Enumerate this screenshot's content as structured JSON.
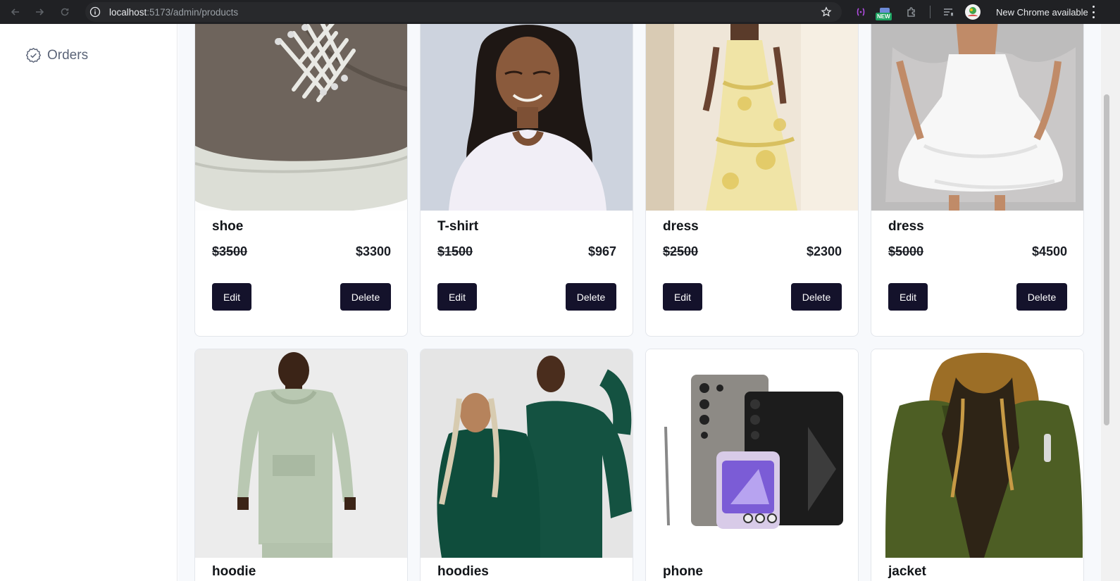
{
  "browser": {
    "url_host": "localhost",
    "url_path": ":5173/admin/products",
    "new_badge": "NEW",
    "update_text": "New Chrome available"
  },
  "sidebar": {
    "items": [
      {
        "label": "Orders",
        "icon": "badge-check-icon"
      }
    ]
  },
  "products_row1": [
    {
      "name": "shoe",
      "old_price": "$3500",
      "price": "$3300",
      "edit_label": "Edit",
      "delete_label": "Delete"
    },
    {
      "name": "T-shirt",
      "old_price": "$1500",
      "price": "$967",
      "edit_label": "Edit",
      "delete_label": "Delete"
    },
    {
      "name": "dress",
      "old_price": "$2500",
      "price": "$2300",
      "edit_label": "Edit",
      "delete_label": "Delete"
    },
    {
      "name": "dress",
      "old_price": "$5000",
      "price": "$4500",
      "edit_label": "Edit",
      "delete_label": "Delete"
    }
  ],
  "products_row2": [
    {
      "name": "hoodie"
    },
    {
      "name": "hoodies"
    },
    {
      "name": "phone"
    },
    {
      "name": "jacket"
    }
  ],
  "colors": {
    "button_bg": "#14122b",
    "page_bg": "#f7f9fc",
    "sidebar_text": "#5b6478"
  }
}
